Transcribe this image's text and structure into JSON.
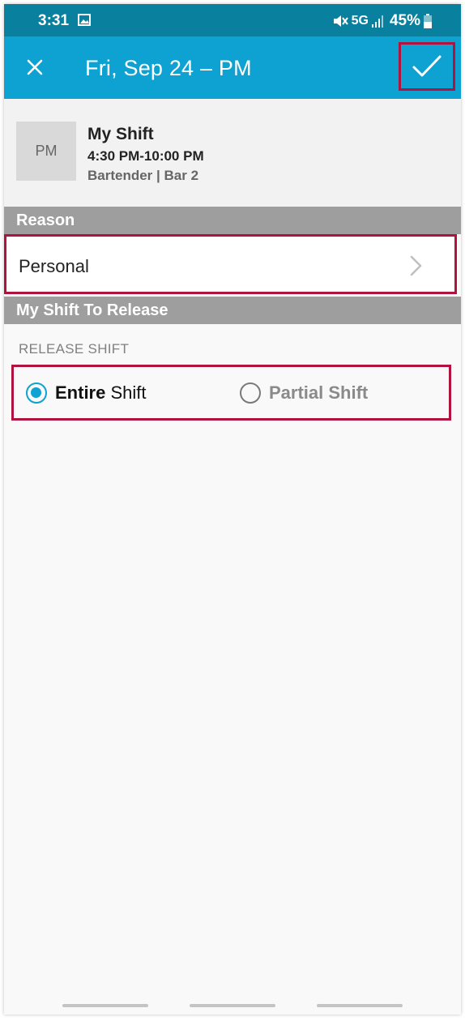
{
  "status_bar": {
    "time": "3:31",
    "network": "5G",
    "battery": "45%",
    "icons": [
      "image-icon",
      "mute-icon",
      "signal-icon",
      "battery-icon"
    ]
  },
  "app_bar": {
    "title": "Fri, Sep 24 – PM",
    "close_icon": "close-icon",
    "confirm_icon": "check-icon"
  },
  "shift": {
    "avatar_text": "PM",
    "title": "My Shift",
    "time": "4:30 PM-10:00 PM",
    "role": "Bartender | Bar 2"
  },
  "sections": {
    "reason_header": "Reason",
    "release_header": "My Shift To Release"
  },
  "reason": {
    "value": "Personal"
  },
  "release": {
    "caption": "RELEASE SHIFT",
    "options": [
      {
        "label_bold": "Entire",
        "label_rest": " Shift",
        "selected": true
      },
      {
        "label": "Partial Shift",
        "selected": false
      }
    ]
  },
  "colors": {
    "status_bar": "#0a809f",
    "app_bar": "#0da2d1",
    "highlight": "#b0133d",
    "section_header": "#9e9e9e"
  }
}
